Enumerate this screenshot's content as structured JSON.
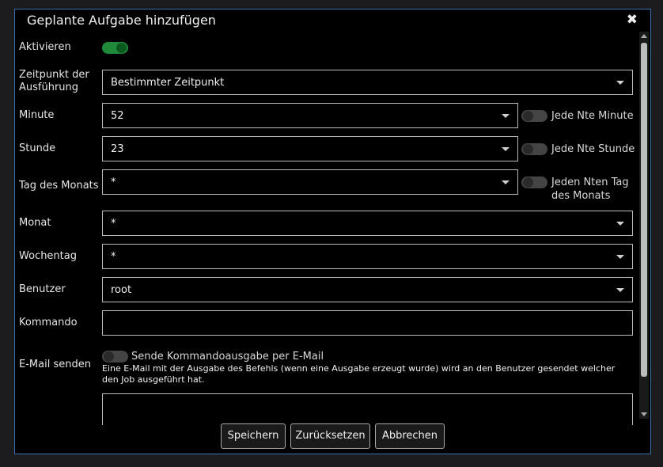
{
  "dialog": {
    "title": "Geplante Aufgabe hinzufügen",
    "close_glyph": "✖"
  },
  "form": {
    "activate": {
      "label": "Aktivieren",
      "enabled": true
    },
    "execution_time": {
      "label_line1": "Zeitpunkt der",
      "label_line2": "Ausführung",
      "value": "Bestimmter Zeitpunkt"
    },
    "minute": {
      "label": "Minute",
      "value": "52",
      "toggle_label": "Jede Nte Minute",
      "toggle_on": false
    },
    "hour": {
      "label": "Stunde",
      "value": "23",
      "toggle_label": "Jede Nte Stunde",
      "toggle_on": false
    },
    "day_of_month": {
      "label": "Tag des Monats",
      "value": "*",
      "toggle_label_line1": "Jeden Nten Tag",
      "toggle_label_line2": "des Monats",
      "toggle_on": false
    },
    "month": {
      "label": "Monat",
      "value": "*"
    },
    "weekday": {
      "label": "Wochentag",
      "value": "*"
    },
    "user": {
      "label": "Benutzer",
      "value": "root"
    },
    "command": {
      "label": "Kommando",
      "value": ""
    },
    "email": {
      "label": "E-Mail senden",
      "toggle_label": "Sende Kommandoausgabe per E-Mail",
      "toggle_on": false,
      "info": "Eine E-Mail mit der Ausgabe des Befehls (wenn eine Ausgabe erzeugt wurde) wird an den Benutzer gesendet welcher den Job ausgeführt hat."
    }
  },
  "buttons": {
    "save": "Speichern",
    "reset": "Zurücksetzen",
    "cancel": "Abbrechen"
  },
  "colors": {
    "accent_border": "#3a6fb0",
    "toggle_on": "#1f8a3a",
    "background": "#000000"
  }
}
